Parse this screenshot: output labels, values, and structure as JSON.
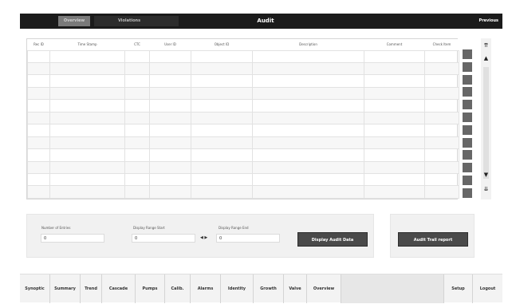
{
  "header": {
    "tabs": [
      {
        "label": "Overview"
      },
      {
        "label": "Violations"
      }
    ],
    "title": "Audit",
    "previous_label": "Previous"
  },
  "table": {
    "columns": [
      "Rec ID",
      "Time Stamp",
      "CTC",
      "User ID",
      "Object ID",
      "Description",
      "Comment",
      "Check Item"
    ],
    "row_count": 12
  },
  "scroll": {
    "top_icon": "⇈",
    "up_icon": "▲",
    "down_icon": "▼",
    "bottom_icon": "⇊"
  },
  "fields": {
    "num_entries": {
      "label": "Number of Entries",
      "value": "0"
    },
    "range_start": {
      "label": "Display Range Start",
      "value": "0"
    },
    "range_end": {
      "label": "Display Range End",
      "value": "0"
    },
    "stepper": "◀ ▶"
  },
  "buttons": {
    "display_audit": "Display Audit Data",
    "audit_report": "Audit Trail report"
  },
  "nav": {
    "items": [
      {
        "label": "Synoptic"
      },
      {
        "label": "Summary"
      },
      {
        "label": "Trend"
      },
      {
        "label": "Cascade"
      },
      {
        "label": "Pumps"
      },
      {
        "label": "Calib."
      },
      {
        "label": "Alarms"
      },
      {
        "label": "Identity"
      },
      {
        "label": "Growth"
      },
      {
        "label": "Valve"
      },
      {
        "label": "Overview"
      }
    ],
    "setup": "Setup",
    "logout": "Logout"
  }
}
